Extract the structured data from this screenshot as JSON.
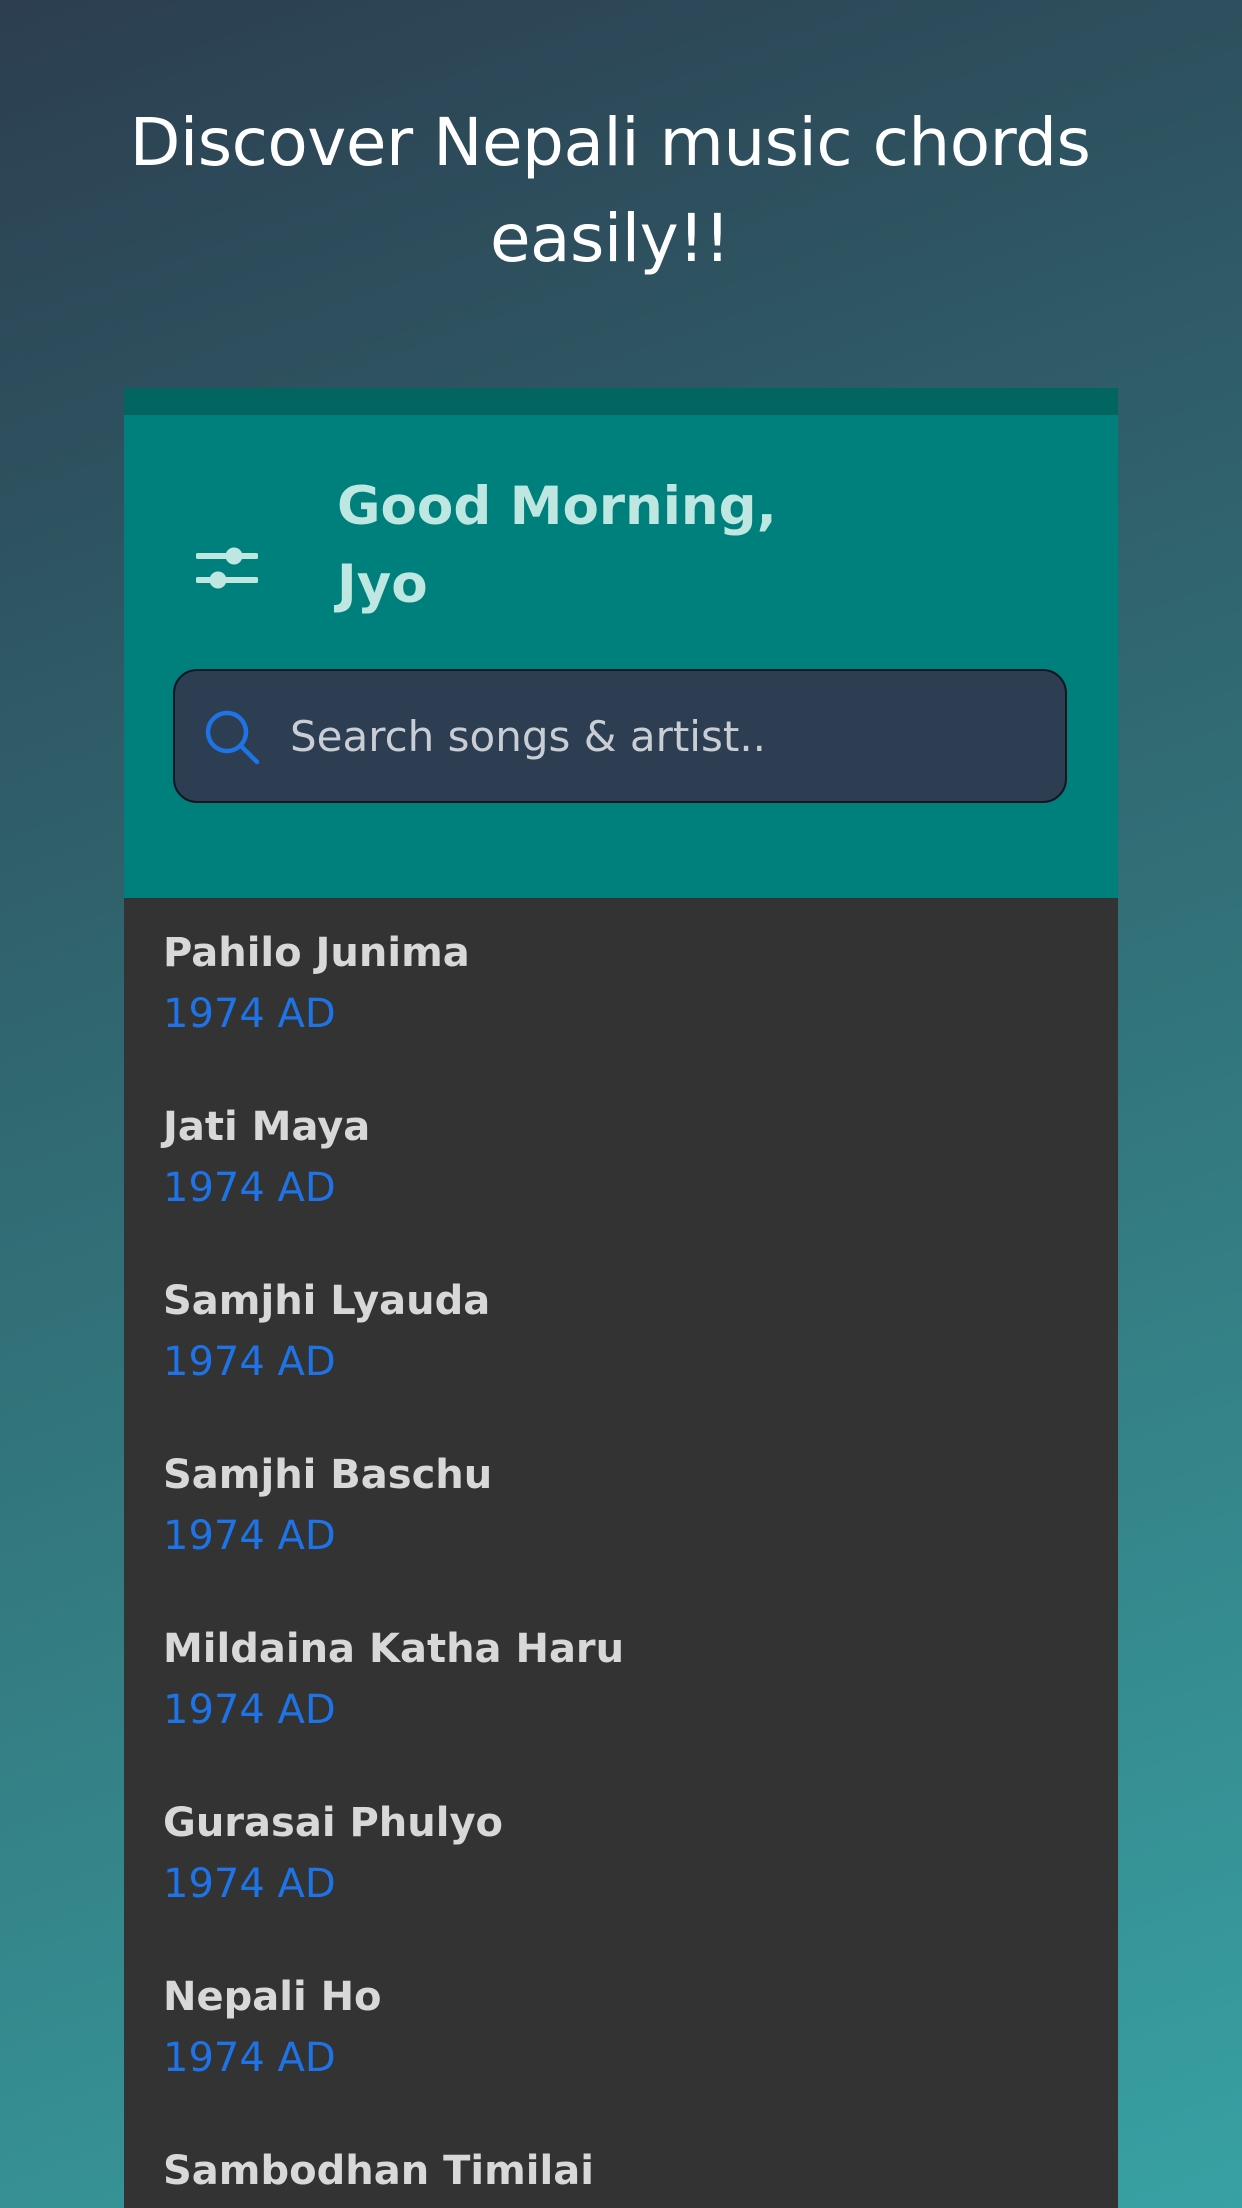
{
  "headline": "Discover Nepali music chords easily!!",
  "header": {
    "greeting_line1": "Good Morning,",
    "greeting_line2": "Jyo",
    "filter_icon": "sliders-icon"
  },
  "search": {
    "placeholder": "Search songs & artist..",
    "icon": "search-icon"
  },
  "songs": [
    {
      "title": "Pahilo Junima",
      "year": "1974 AD"
    },
    {
      "title": "Jati Maya",
      "year": "1974 AD"
    },
    {
      "title": "Samjhi Lyauda",
      "year": "1974 AD"
    },
    {
      "title": "Samjhi Baschu",
      "year": "1974 AD"
    },
    {
      "title": "Mildaina Katha Haru",
      "year": "1974 AD"
    },
    {
      "title": "Gurasai Phulyo",
      "year": "1974 AD"
    },
    {
      "title": "Nepali Ho",
      "year": "1974 AD"
    },
    {
      "title": "Sambodhan Timilai",
      "year": ""
    }
  ],
  "colors": {
    "header_bg": "#00807d",
    "topbar_bg": "#02655f",
    "list_bg": "#333333",
    "accent_year": "#1e73e6",
    "search_bg": "#2d3e52"
  }
}
